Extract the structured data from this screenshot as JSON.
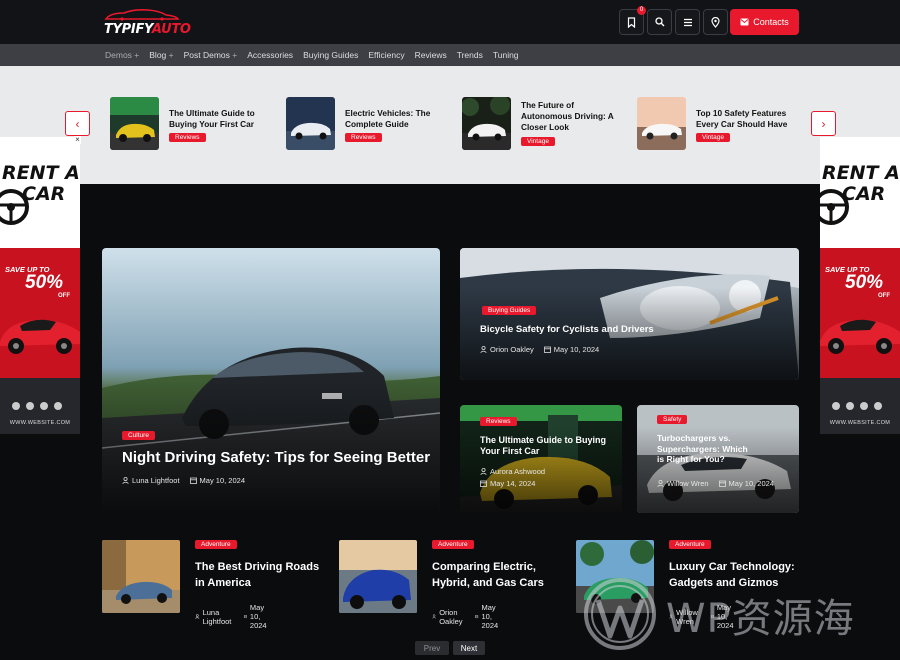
{
  "brand": {
    "logo_main": "TYPIFY",
    "logo_accent": "AUTO"
  },
  "header": {
    "bookmark_count": "0",
    "contact_label": "Contacts",
    "icons": [
      "bookmark-icon",
      "search-icon",
      "menu-icon",
      "location-pin-icon",
      "envelope-icon"
    ]
  },
  "nav": {
    "items": [
      {
        "label": "Demos",
        "sub": true
      },
      {
        "label": "Blog",
        "sub": true
      },
      {
        "label": "Post Demos",
        "sub": true
      },
      {
        "label": "Accessories"
      },
      {
        "label": "Buying Guides"
      },
      {
        "label": "Efficiency"
      },
      {
        "label": "Reviews"
      },
      {
        "label": "Trends"
      },
      {
        "label": "Tuning"
      }
    ]
  },
  "slider": {
    "items": [
      {
        "title": "The Ultimate Guide to Buying Your First Car",
        "tag": "Reviews"
      },
      {
        "title": "Electric Vehicles: The Complete Guide",
        "tag": "Reviews"
      },
      {
        "title": "The Future of Autonomous Driving: A Closer Look",
        "tag": "Vintage"
      },
      {
        "title": "Top 10 Safety Features Every Car Should Have",
        "tag": "Vintage"
      }
    ],
    "prev_icon": "chevron-left-icon",
    "next_icon": "chevron-right-icon"
  },
  "ad": {
    "line1": "RENT A",
    "line2": "CAR",
    "save": "SAVE UP TO",
    "percent": "50%",
    "off": "OFF",
    "site": "WWW.WEBSITE.COM",
    "close": "×"
  },
  "featured": {
    "main": {
      "category": "Culture",
      "title": "Night Driving Safety: Tips for Seeing Better",
      "author": "Luna Lightfoot",
      "date": "May 10, 2024"
    },
    "top_right": {
      "category": "Buying Guides",
      "title": "Bicycle Safety for Cyclists and Drivers",
      "author": "Orion Oakley",
      "date": "May 10, 2024"
    },
    "small_left": {
      "category": "Reviews",
      "title": "The Ultimate Guide to Buying Your First Car",
      "author": "Aurora Ashwood",
      "date": "May 14, 2024"
    },
    "small_right": {
      "category": "Safety",
      "title": "Turbochargers vs. Superchargers: Which is Right for You?",
      "author": "Willow Wren",
      "date": "May 10, 2024"
    }
  },
  "list": [
    {
      "category": "Adventure",
      "title": "The Best Driving Roads in America",
      "author": "Luna Lightfoot",
      "date": "May 10, 2024"
    },
    {
      "category": "Adventure",
      "title": "Comparing Electric, Hybrid, and Gas Cars",
      "author": "Orion Oakley",
      "date": "May 10, 2024"
    },
    {
      "category": "Adventure",
      "title": "Luxury Car Technology: Gadgets and Gizmos",
      "author": "Willow Wren",
      "date": "May 10, 2024"
    }
  ],
  "pagination": {
    "prev": "Prev",
    "next": "Next"
  },
  "watermark": {
    "text": "WP资源海"
  },
  "colors": {
    "accent": "#e8192c",
    "header_bg": "#111317",
    "nav_bg": "#3d3f44",
    "page_bg": "#0b0c0e",
    "strip_bg": "#e9eaec"
  }
}
